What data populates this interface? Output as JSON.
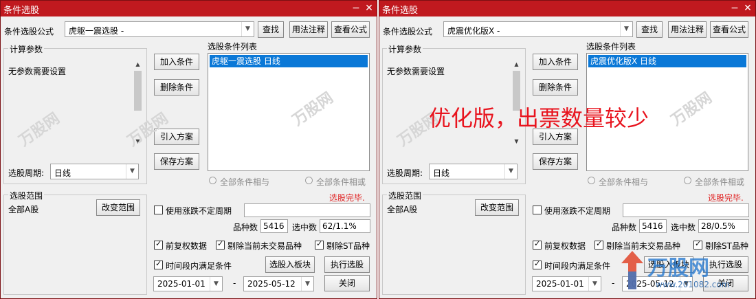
{
  "left": {
    "title": "条件选股",
    "formula_label": "条件选股公式",
    "formula_value": "虎躯一震选股  -",
    "btn_search": "查找",
    "btn_usage": "用法注释",
    "btn_view": "查看公式",
    "calc_group": "计算参数",
    "no_params": "无参数需要设置",
    "period_label": "选股周期:",
    "period_value": "日线",
    "btn_add": "加入条件",
    "btn_delete": "删除条件",
    "btn_import": "引入方案",
    "btn_save": "保存方案",
    "list_label": "选股条件列表",
    "list_item": "虎躯一震选股  日线",
    "radio_and": "全部条件相与",
    "radio_or": "全部条件相或",
    "range_group": "选股范围",
    "range_value": "全部A股",
    "btn_change_range": "改变范围",
    "status": "选股完毕.",
    "chk_variable_period": "使用涨跌不定周期",
    "count_label": "品种数",
    "count_value": "5416",
    "hit_label": "选中数",
    "hit_value": "62/1.1%",
    "chk_adjusted": "前复权数据",
    "chk_exclude_untraded": "剔除当前未交易品种",
    "chk_exclude_st": "剔除ST品种",
    "chk_period_satisfy": "时间段内满足条件",
    "btn_to_block": "选股入板块",
    "btn_execute": "执行选股",
    "date_from": "2025-01-01",
    "date_dash": "-",
    "date_to": "2025-05-12",
    "btn_close": "关闭"
  },
  "right": {
    "title": "条件选股",
    "formula_label": "条件选股公式",
    "formula_value": "虎震优化版X  -",
    "btn_search": "查找",
    "btn_usage": "用法注释",
    "btn_view": "查看公式",
    "calc_group": "计算参数",
    "no_params": "无参数需要设置",
    "period_label": "选股周期:",
    "period_value": "日线",
    "btn_add": "加入条件",
    "btn_delete": "删除条件",
    "btn_import": "引入方案",
    "btn_save": "保存方案",
    "list_label": "选股条件列表",
    "list_item": "虎震优化版X  日线",
    "radio_and": "全部条件相与",
    "radio_or": "全部条件相或",
    "range_group": "选股范围",
    "range_value": "全部A股",
    "btn_change_range": "改变范围",
    "status": "选股完毕.",
    "chk_variable_period": "使用涨跌不定周期",
    "count_label": "品种数",
    "count_value": "5416",
    "hit_label": "选中数",
    "hit_value": "28/0.5%",
    "chk_adjusted": "前复权数据",
    "chk_exclude_untraded": "剔除当前未交易品种",
    "chk_exclude_st": "剔除ST品种",
    "chk_period_satisfy": "时间段内满足条件",
    "btn_to_block": "选股入板块",
    "btn_execute": "执行选股",
    "date_from": "2025-01-01",
    "date_dash": "-",
    "date_to": "2025-05-12",
    "btn_close": "关闭"
  },
  "annotation": "优化版，出票数量较少",
  "watermark": {
    "brand": "万股网",
    "url": "www.201082.com"
  },
  "colors": {
    "titlebar": "#c0191f",
    "selection": "#0a78d7",
    "status": "#e02020",
    "annotation": "#e8141e"
  }
}
